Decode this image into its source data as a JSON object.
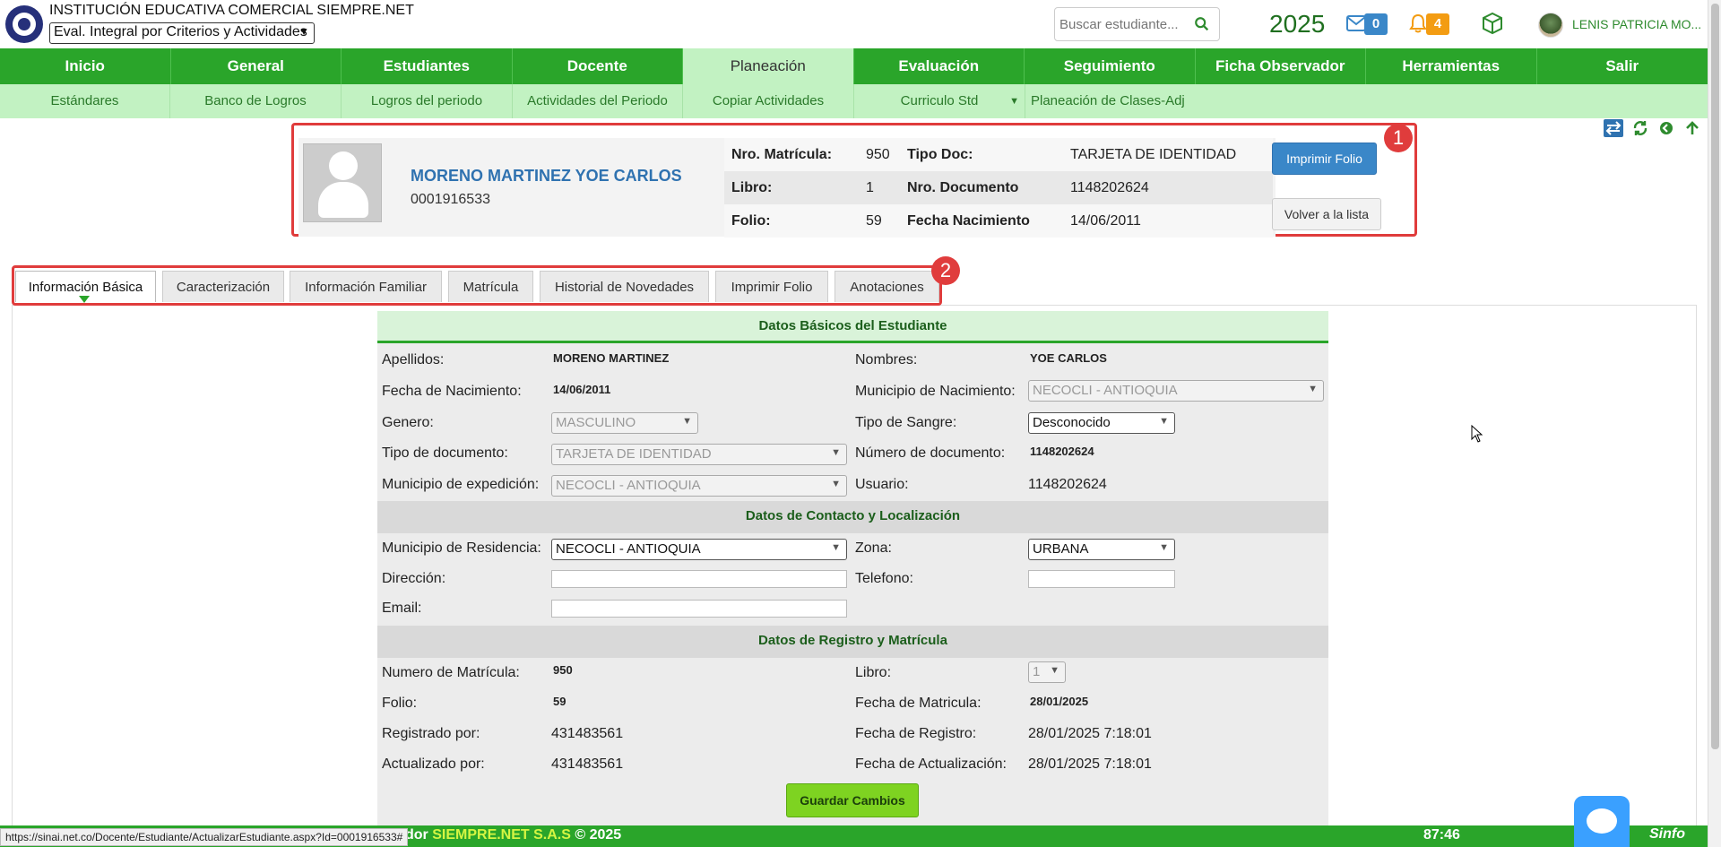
{
  "header": {
    "institution": "INSTITUCIÓN EDUCATIVA COMERCIAL SIEMPRE.NET",
    "eval_mode": "Eval. Integral por Criterios y Actividades",
    "search_placeholder": "Buscar estudiante...",
    "year": "2025",
    "mail_count": "0",
    "notif_count": "4",
    "user_name": "LENIS PATRICIA MO...",
    "icons": [
      "search-icon",
      "mail-icon",
      "bell-icon",
      "cube-icon"
    ]
  },
  "nav": {
    "items": [
      "Inicio",
      "General",
      "Estudiantes",
      "Docente",
      "Planeación",
      "Evaluación",
      "Seguimiento",
      "Ficha Observador",
      "Herramientas",
      "Salir"
    ],
    "active": "Planeación",
    "sub_items": [
      "Estándares",
      "Banco de Logros",
      "Logros del periodo",
      "Actividades del Periodo",
      "Copiar Actividades",
      "Curriculo Std",
      "Planeación de Clases-Adj"
    ]
  },
  "student": {
    "name": "MORENO MARTINEZ  YOE CARLOS",
    "code": "0001916533",
    "rows": [
      {
        "l1": "Nro. Matrícula:",
        "v1": "950",
        "l2": "Tipo Doc:",
        "v2": "TARJETA DE IDENTIDAD"
      },
      {
        "l1": "Libro:",
        "v1": "1",
        "l2": "Nro. Documento",
        "v2": "1148202624"
      },
      {
        "l1": "Folio:",
        "v1": "59",
        "l2": "Fecha Nacimiento",
        "v2": "14/06/2011"
      }
    ],
    "print_button": "Imprimir Folio",
    "back_button": "Volver a la lista",
    "marker1": "1",
    "marker2": "2"
  },
  "tabs": [
    "Información Básica",
    "Caracterización",
    "Información Familiar",
    "Matrícula",
    "Historial de Novedades",
    "Imprimir Folio",
    "Anotaciones"
  ],
  "form": {
    "sec1": "Datos Básicos del Estudiante",
    "apellidos_lbl": "Apellidos:",
    "apellidos": "MORENO MARTINEZ",
    "nombres_lbl": "Nombres:",
    "nombres": "YOE CARLOS",
    "fnac_lbl": "Fecha de Nacimiento:",
    "fnac": "14/06/2011",
    "munnac_lbl": "Municipio de Nacimiento:",
    "munnac": "NECOCLI - ANTIOQUIA",
    "genero_lbl": "Genero:",
    "genero": "MASCULINO",
    "sangre_lbl": "Tipo de Sangre:",
    "sangre": "Desconocido",
    "tipodoc_lbl": "Tipo de documento:",
    "tipodoc": "TARJETA DE IDENTIDAD",
    "numdoc_lbl": "Número de documento:",
    "numdoc": "1148202624",
    "munexp_lbl": "Municipio de expedición:",
    "munexp": "NECOCLI - ANTIOQUIA",
    "usuario_lbl": "Usuario:",
    "usuario": "1148202624",
    "sec2": "Datos de Contacto y Localización",
    "munres_lbl": "Municipio de Residencia:",
    "munres": "NECOCLI - ANTIOQUIA",
    "zona_lbl": "Zona:",
    "zona": "URBANA",
    "dir_lbl": "Dirección:",
    "tel_lbl": "Telefono:",
    "email_lbl": "Email:",
    "sec3": "Datos de Registro y Matrícula",
    "nummat_lbl": "Numero de Matrícula:",
    "nummat": "950",
    "libro_lbl": "Libro:",
    "libro": "1",
    "folio_lbl": "Folio:",
    "folio": "59",
    "fmat_lbl": "Fecha de Matricula:",
    "fmat": "28/01/2025",
    "regpor_lbl": "Registrado por:",
    "regpor": "431483561",
    "freg_lbl": "Fecha de Registro:",
    "freg": "28/01/2025 7:18:01",
    "actpor_lbl": "Actualizado por:",
    "actpor": "431483561",
    "fact_lbl": "Fecha de Actualización:",
    "fact": "28/01/2025 7:18:01",
    "save_button": "Guardar Cambios"
  },
  "footer": {
    "status_url": "https://sinai.net.co/Docente/Estudiante/ActualizarEstudiante.aspx?Id=0001916533#",
    "prefix": "dor ",
    "brand": "SIEMPRE.NET S.A.S",
    "copy": "© 2025",
    "time": "87:46",
    "logo": "Sinfo"
  },
  "colors": {
    "nav_green": "#2aa52a",
    "sub_green": "#c2f2c2",
    "highlight_red": "#e03c3c",
    "link_blue": "#2f72b0"
  }
}
